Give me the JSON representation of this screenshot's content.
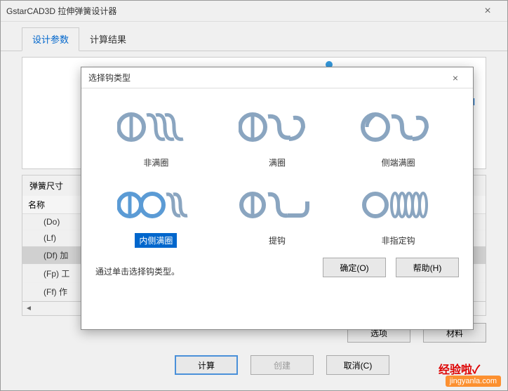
{
  "window": {
    "title": "GstarCAD3D 拉伸弹簧设计器",
    "close": "×"
  },
  "tabs": {
    "design": "设计参数",
    "result": "计算结果"
  },
  "canvas": {
    "marker": "d"
  },
  "param": {
    "section_title": "弹簧尺寸",
    "header": "名称",
    "rows": {
      "do": "(Do)",
      "lf": "(Lf)",
      "df": "(Df) 加",
      "fp": "(Fp) 工",
      "ff": "(Ff) 作"
    }
  },
  "buttons": {
    "options": "选项",
    "material": "材料",
    "calculate": "计算",
    "create": "创建",
    "cancel": "取消(C)"
  },
  "modal": {
    "title": "选择钩类型",
    "close": "×",
    "hint": "通过单击选择钩类型。",
    "ok": "确定(O)",
    "help": "帮助(H)",
    "hooks": {
      "h1": "非满圈",
      "h2": "满圈",
      "h3": "侧端满圈",
      "h4": "内侧满圈",
      "h5": "提钩",
      "h6": "非指定钩"
    }
  },
  "watermark": {
    "brand": "经验啦",
    "url": "jingyanla.com",
    "check": "✓"
  }
}
